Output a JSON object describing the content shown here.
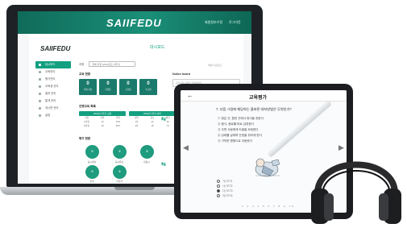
{
  "laptop": {
    "app_title": "SAIIFEDU",
    "top_links": [
      "회원정보수정",
      "로그아웃"
    ],
    "sidebar_logo": "SAIIFEDU",
    "page_title": "대시보드",
    "page_util": "엑셀 다운로드",
    "filter": {
      "label": "과정",
      "selected": "전체 과정 (2024년도 2학기)"
    },
    "sidebar_items": [
      {
        "label": "대시보드"
      },
      {
        "label": "교육관리"
      },
      {
        "label": "평가관리"
      },
      {
        "label": "교육생 관리"
      },
      {
        "label": "결과 관리"
      },
      {
        "label": "통계 관리"
      },
      {
        "label": "게시판 관리"
      },
      {
        "label": "설정"
      }
    ],
    "section_status": "교육 현황",
    "stats": [
      {
        "value": "0",
        "label": "전체 과정"
      },
      {
        "value": "0",
        "label": "진행중"
      },
      {
        "value": "0",
        "label": "교육생"
      },
      {
        "value": "0",
        "label": "수료생"
      }
    ],
    "notice": {
      "title": "Notice board",
      "placeholder": "공지사항 내용을 입력하세요"
    },
    "section_table": "진행교육 목록",
    "tables": [
      {
        "header": "2024년 2학기 교육",
        "rows": [
          [
            "과정",
            "인원",
            "진행"
          ],
          [
            "A과정",
            "20",
            "70%"
          ],
          [
            "B과정",
            "18",
            "55%"
          ]
        ]
      },
      {
        "header": "2024년 2학기 평가",
        "rows": [
          [
            "평가",
            "응시",
            "평균"
          ],
          [
            "1차",
            "20",
            "82"
          ],
          [
            "2차",
            "18",
            "76"
          ]
        ]
      }
    ],
    "section_circles": "평가 현황",
    "circles": [
      {
        "value": "0",
        "label": "응시대상"
      },
      {
        "value": "0",
        "label": "응시완료"
      },
      {
        "value": "0",
        "label": "미응시"
      },
      {
        "value": "0",
        "label": "합격"
      },
      {
        "value": "0",
        "label": "불합격"
      }
    ]
  },
  "tablet": {
    "title": "교육평가",
    "question": "7. 다음 그림에 해당하는 올바른 대처방법은 무엇인가?",
    "options": [
      "① 밝은 곳, 환한 곳에서 휴식을 취한다",
      "② 음식, 음료를 바로 섭취한다",
      "③ 주변 사람에게 도움을 요청한다",
      "④ 상태를 살피며 안정을 취하게 한다",
      "⑤ 가까운 병원으로 이동한다"
    ],
    "answers": [
      "가) 보기1",
      "나) 보기2",
      "다) 보기3",
      "라) 보기4"
    ],
    "selected_answer_index": 2,
    "pagination": "1 2 3 4 5 6 7 8 9 10"
  },
  "colors": {
    "brand_green": "#13a080",
    "header_dark": "#0f6b5a",
    "device_frame": "#1b1d20"
  }
}
